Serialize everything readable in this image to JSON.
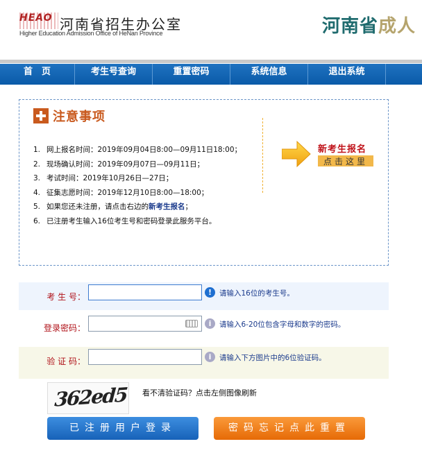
{
  "header": {
    "logo_text": "HEAO",
    "site_name": "河南省招生办公室",
    "site_name_en": "Higher Education Admission Office of HeNan Province",
    "right_title_main": "河南省",
    "right_title_highlight": "成人"
  },
  "nav": {
    "items": [
      "首　页",
      "考生号查询",
      "重置密码",
      "系统信息",
      "退出系统"
    ]
  },
  "notice": {
    "title": "注意事项",
    "items": [
      {
        "num": "1.",
        "text": "网上报名时间：2019年09月04日8:00—09月11日18:00；"
      },
      {
        "num": "2.",
        "text": "现场确认时间：2019年09月07日—09月11日；"
      },
      {
        "num": "3.",
        "text": "考试时间：2019年10月26日—27日；"
      },
      {
        "num": "4.",
        "text": "征集志愿时间：2019年12月10日8:00—18:00；"
      },
      {
        "num": "5.",
        "text_before": "如果您还未注册，请点击右边的",
        "text_em": "新考生报名",
        "text_after": "；"
      },
      {
        "num": "6.",
        "text": "已注册考生输入16位考生号和密码登录此服务平台。"
      }
    ],
    "register_title": "新考生报名",
    "register_button": "点击这里"
  },
  "form": {
    "exam_no": {
      "label": "考 生 号：",
      "value": "",
      "hint": "请输入16位的考生号。"
    },
    "password": {
      "label": "登录密码：",
      "value": "",
      "hint": "请输入6-20位包含字母和数字的密码。"
    },
    "captcha": {
      "label": "验 证 码：",
      "value": "",
      "hint": "请输入下方图片中的6位验证码。"
    }
  },
  "captcha_image": {
    "text": "362ed5",
    "refresh_hint": "看不清验证码？点击左侧图像刷新"
  },
  "buttons": {
    "login": "已注册用户登录",
    "reset": "密码忘记点此重置"
  },
  "colors": {
    "nav_blue": "#0a5aa8",
    "accent_orange": "#c95a1e",
    "label_red": "#b0131a",
    "link_blue": "#1a3a8c"
  }
}
